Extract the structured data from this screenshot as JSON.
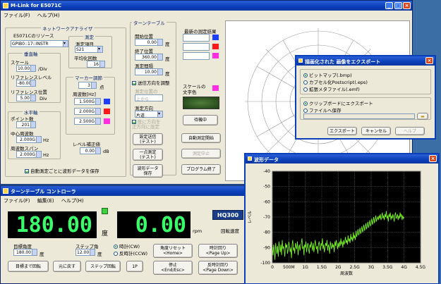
{
  "main_window": {
    "title": "M-Link for E5071C",
    "menu": [
      "ファイル(F)",
      "ヘルプ(H)"
    ]
  },
  "analyzer": {
    "group": "ネットワークアナライザ",
    "resource_label": "E5071Cのリソース",
    "resource_value": "GPIB0::17::INSTR",
    "vertical_axis": "垂直軸",
    "scale_label": "スケール",
    "scale_value": "10.00",
    "scale_unit": "/Div",
    "ref_level_label": "リファレンスレベル",
    "ref_level_value": "-80.00",
    "ref_pos_label": "リファレンス位置",
    "ref_pos_value": "5.00",
    "ref_pos_unit": "Div",
    "horizontal_axis": "水平軸",
    "points_label": "ポイント数",
    "points_value": "201",
    "center_label": "中心周波数",
    "center_value": "2.000G",
    "center_unit": "Hz",
    "span_label": "周波数スパン",
    "span_value": "2.000G",
    "span_unit": "Hz",
    "measure_label": "測定",
    "measure_item_label": "測定項目",
    "measure_item_value": "S21",
    "avg_label": "平均化回数",
    "avg_value": "16",
    "marker_label": "マーカー調節",
    "marker_value": "3",
    "marker_unit": "点",
    "freq_label": "周波数[Hz]",
    "marker_freqs": [
      "1.500G",
      "2.000G",
      "2.500G"
    ],
    "level_label": "レベル補正値",
    "level_value": "0.00",
    "level_unit": "dB",
    "auto_save_label": "自動測定ごとに波形データを保存"
  },
  "turntable": {
    "group": "ターンテーブル",
    "start_label": "開始位置",
    "start_value": "0.00",
    "end_label": "終了位置",
    "end_value": "360.00",
    "interval_label": "測定間隔",
    "interval_value": "10.00",
    "deg": "度",
    "chk_label": "送信方向を調整",
    "target_label": "測定位置の",
    "target_value": "上から",
    "dir_label": "測定方向",
    "dir_value": "片道",
    "chk2_label": "既に方向を\n正方向に設定",
    "btn_setting": "設定送信\n(テスト)",
    "btn_single": "一点測定\n(テスト)",
    "btn_wave": "波形データ\n保存",
    "btn_wait": "待機中",
    "btn_auto": "自動測定開始",
    "btn_stop": "測定中止",
    "btn_exit": "プログラム終了"
  },
  "results": {
    "label": "最新の測定結果",
    "values": [
      "",
      "",
      ""
    ],
    "scale_color_label": "スケールの\n文字色"
  },
  "export_dialog": {
    "title": "描画化された 画像をエクスポート",
    "options": [
      "ビットマップ(.bmp)",
      "カプセル化Postscript(.eps)",
      "拡張メタファイル(.emf)",
      "クリップボードにエクスポート",
      "ファイルへ保存"
    ],
    "btn_export": "エクスポート",
    "btn_cancel": "キャンセル",
    "btn_help": "ヘルプ"
  },
  "turntable_window": {
    "title": "ターンテーブル コントローラ",
    "menu": [
      "ファイル(F)",
      "編集(E)",
      "ヘルプ(H)"
    ],
    "angle_value": "180.00",
    "angle_unit": "度",
    "speed_value": "0.00",
    "speed_unit": "rpm",
    "model": "HQ300",
    "speed_label": "回転速度",
    "target_label": "目標角度",
    "target_value": "180.00",
    "target_unit": "度",
    "step_label": "ステップ角",
    "step_value": "12.00",
    "step_unit": "度",
    "cw_label": "時計(CW)",
    "ccw_label": "反時計(CCW)",
    "btn_rotate": "目標まで回転",
    "btn_return": "元に戻す",
    "btn_step": "ステップ回転",
    "btn_1p": "1P",
    "btn_reset": "角度リセット\n<Home>",
    "btn_cw": "時計回り\n<Page Up>",
    "btn_stop": "停止\n<End/Esc>",
    "btn_ccw": "反時計回り\n<Page Down>"
  },
  "wave_window": {
    "title": "波形データ"
  },
  "chart_data": {
    "type": "line",
    "xlabel": "周波数",
    "ylabel": "レベル",
    "x_ticks": [
      "0",
      "500M",
      "1G",
      "1.5G",
      "2G",
      "2.5G",
      "3G",
      "3.5G",
      "4G",
      "4.5G"
    ],
    "y_ticks": [
      "-40",
      "-50",
      "-60",
      "-70",
      "-80",
      "-90",
      "-100"
    ],
    "xlim": [
      0,
      4.5
    ],
    "ylim": [
      -100,
      -40
    ],
    "series": [
      {
        "x": [
          0.0,
          0.02,
          0.04,
          0.06,
          0.08,
          0.1,
          0.12,
          0.14,
          0.16,
          0.18,
          0.2,
          0.22,
          0.24,
          0.26,
          0.28,
          0.3,
          0.32,
          0.34,
          0.36,
          0.38,
          0.4,
          0.42,
          0.44,
          0.46,
          0.48,
          0.5,
          0.52,
          0.54,
          0.56,
          0.58,
          0.6,
          0.62,
          0.64,
          0.66,
          0.68,
          0.7,
          0.72,
          0.74,
          0.76,
          0.78,
          0.8,
          0.82,
          0.84,
          0.86,
          0.88,
          0.9,
          0.92,
          0.94,
          0.96,
          0.98,
          1.0,
          1.02,
          1.04,
          1.06,
          1.08,
          1.1,
          1.12,
          1.14,
          1.16,
          1.18,
          1.2,
          1.22,
          1.24,
          1.26,
          1.28,
          1.3,
          1.32,
          1.34,
          1.36,
          1.38,
          1.4,
          1.42,
          1.44,
          1.46,
          1.48,
          1.5,
          1.52,
          1.54,
          1.56,
          1.58,
          1.6,
          1.62,
          1.64,
          1.66,
          1.68,
          1.7,
          1.72,
          1.74,
          1.76,
          1.78,
          1.8,
          1.82,
          1.84,
          1.86,
          1.88,
          1.9,
          1.92,
          1.94,
          1.96,
          1.98,
          2.0,
          2.02,
          2.04,
          2.06,
          2.08,
          2.1,
          2.12,
          2.14,
          2.16,
          2.18,
          2.2,
          2.22,
          2.24,
          2.26,
          2.28,
          2.3,
          2.32,
          2.34,
          2.36,
          2.38,
          2.4,
          2.42,
          2.44,
          2.46,
          2.48,
          2.5,
          2.52,
          2.54,
          2.56,
          2.58,
          2.6,
          2.62,
          2.64,
          2.66,
          2.68,
          2.7,
          2.72,
          2.74,
          2.76,
          2.78,
          2.8,
          2.82,
          2.84,
          2.86,
          2.88,
          2.9,
          2.92,
          2.94,
          2.96,
          2.98,
          3.0,
          3.02,
          3.04,
          3.06,
          3.08,
          3.1,
          3.12,
          3.14,
          3.16,
          3.18,
          3.2,
          3.22,
          3.24,
          3.26,
          3.28,
          3.3,
          3.32,
          3.34,
          3.36,
          3.38,
          3.4,
          3.42,
          3.44,
          3.46,
          3.48,
          3.5,
          3.52,
          3.54,
          3.56,
          3.58,
          3.6,
          3.62,
          3.64,
          3.66,
          3.68,
          3.7,
          3.72,
          3.74,
          3.76,
          3.78,
          3.8,
          3.82,
          3.84,
          3.86,
          3.88,
          3.9,
          3.92,
          3.94,
          3.96,
          3.98,
          4.0
        ],
        "y": [
          -90,
          -95,
          -88,
          -92,
          -98,
          -87,
          -91,
          -94,
          -89,
          -96,
          -86,
          -90,
          -93,
          -88,
          -95,
          -85,
          -91,
          -89,
          -92,
          -96,
          -87,
          -90,
          -88,
          -94,
          -91,
          -86,
          -89,
          -93,
          -90,
          -97,
          -88,
          -85,
          -92,
          -90,
          -94,
          -87,
          -89,
          -91,
          -86,
          -95,
          -90,
          -88,
          -92,
          -89,
          -87,
          -84,
          -91,
          -89,
          -95,
          -88,
          -90,
          -86,
          -93,
          -89,
          -87,
          -91,
          -94,
          -88,
          -90,
          -86,
          -89,
          -92,
          -87,
          -93,
          -90,
          -85,
          -88,
          -91,
          -89,
          -94,
          -88,
          -86,
          -90,
          -92,
          -87,
          -89,
          -84,
          -91,
          -88,
          -93,
          -90,
          -87,
          -89,
          -85,
          -92,
          -88,
          -90,
          -94,
          -86,
          -89,
          -91,
          -87,
          -90,
          -88,
          -93,
          -86,
          -89,
          -85,
          -88,
          -91,
          -87,
          -90,
          -86,
          -89,
          -84,
          -88,
          -86,
          -90,
          -85,
          -88,
          -86,
          -83,
          -87,
          -85,
          -88,
          -82,
          -86,
          -84,
          -87,
          -81,
          -85,
          -83,
          -86,
          -80,
          -84,
          -82,
          -85,
          -79,
          -83,
          -81,
          -78,
          -82,
          -80,
          -77,
          -81,
          -79,
          -76,
          -80,
          -78,
          -75,
          -79,
          -77,
          -74,
          -78,
          -76,
          -73,
          -77,
          -75,
          -72,
          -76,
          -74,
          -71,
          -75,
          -73,
          -70,
          -74,
          -72,
          -69,
          -73,
          -71,
          -70,
          -72,
          -69,
          -71,
          -68,
          -72,
          -70,
          -67,
          -71,
          -69,
          -72,
          -68,
          -70,
          -66,
          -71,
          -69,
          -73,
          -68,
          -70,
          -67,
          -72,
          -69,
          -71,
          -68,
          -70,
          -73,
          -69,
          -67,
          -71,
          -70,
          -68,
          -72,
          -69,
          -71,
          -67,
          -70,
          -68,
          -72,
          -69,
          -71,
          -70
        ]
      }
    ]
  }
}
